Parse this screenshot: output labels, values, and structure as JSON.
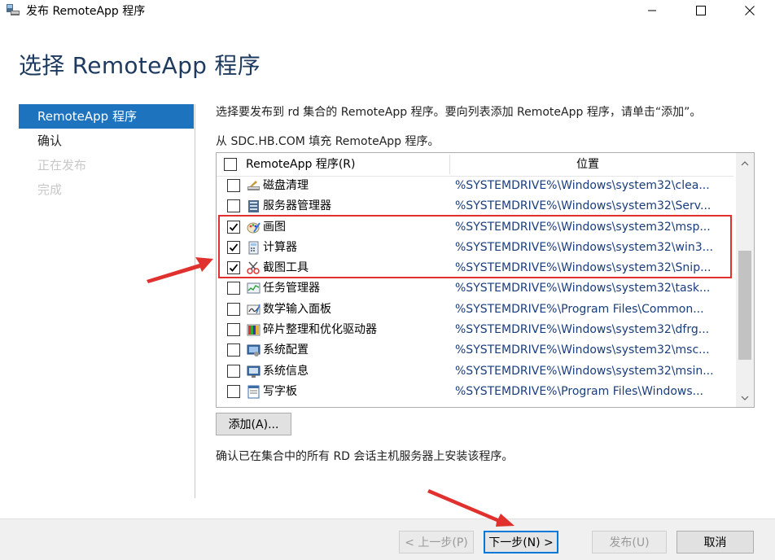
{
  "window": {
    "title": "发布 RemoteApp 程序",
    "controls": {
      "minimize": "minimize-icon",
      "maximize": "maximize-icon",
      "close": "close-icon"
    }
  },
  "page": {
    "title": "选择 RemoteApp 程序"
  },
  "nav": {
    "items": [
      {
        "label": "RemoteApp 程序",
        "state": "active"
      },
      {
        "label": "确认",
        "state": "normal"
      },
      {
        "label": "正在发布",
        "state": "disabled"
      },
      {
        "label": "完成",
        "state": "disabled"
      }
    ]
  },
  "main": {
    "instruction": "选择要发布到 rd 集合的 RemoteApp 程序。要向列表添加 RemoteApp 程序，请单击“添加”。",
    "source": "从 SDC.HB.COM 填充 RemoteApp 程序。",
    "table": {
      "columns": [
        "RemoteApp 程序(R)",
        "位置"
      ],
      "rows": [
        {
          "name": "磁盘清理",
          "location": "%SYSTEMDRIVE%\\Windows\\system32\\clea...",
          "checked": false,
          "icon": "disk-cleanup-icon"
        },
        {
          "name": "服务器管理器",
          "location": "%SYSTEMDRIVE%\\Windows\\system32\\Serv...",
          "checked": false,
          "icon": "server-manager-icon"
        },
        {
          "name": "画图",
          "location": "%SYSTEMDRIVE%\\Windows\\system32\\msp...",
          "checked": true,
          "icon": "paint-icon"
        },
        {
          "name": "计算器",
          "location": "%SYSTEMDRIVE%\\Windows\\system32\\win3...",
          "checked": true,
          "icon": "calculator-icon"
        },
        {
          "name": "截图工具",
          "location": "%SYSTEMDRIVE%\\Windows\\system32\\Snip...",
          "checked": true,
          "icon": "snipping-tool-icon"
        },
        {
          "name": "任务管理器",
          "location": "%SYSTEMDRIVE%\\Windows\\system32\\task...",
          "checked": false,
          "icon": "task-manager-icon"
        },
        {
          "name": "数学输入面板",
          "location": "%SYSTEMDRIVE%\\Program Files\\Common...",
          "checked": false,
          "icon": "math-input-icon"
        },
        {
          "name": "碎片整理和优化驱动器",
          "location": "%SYSTEMDRIVE%\\Windows\\system32\\dfrg...",
          "checked": false,
          "icon": "defrag-icon"
        },
        {
          "name": "系统配置",
          "location": "%SYSTEMDRIVE%\\Windows\\system32\\msc...",
          "checked": false,
          "icon": "system-config-icon"
        },
        {
          "name": "系统信息",
          "location": "%SYSTEMDRIVE%\\Windows\\system32\\msin...",
          "checked": false,
          "icon": "system-info-icon"
        },
        {
          "name": "写字板",
          "location": "%SYSTEMDRIVE%\\Program Files\\Windows...",
          "checked": false,
          "icon": "wordpad-icon"
        }
      ]
    },
    "add_button": "添加(A)...",
    "confirm_text": "确认已在集合中的所有 RD 会话主机服务器上安装该程序。"
  },
  "footer": {
    "prev": "< 上一步(P)",
    "next": "下一步(N) >",
    "publish": "发布(U)",
    "cancel": "取消"
  },
  "colors": {
    "accent": "#1e73be",
    "highlight": "#e0312f",
    "heading": "#1e3a5f"
  }
}
